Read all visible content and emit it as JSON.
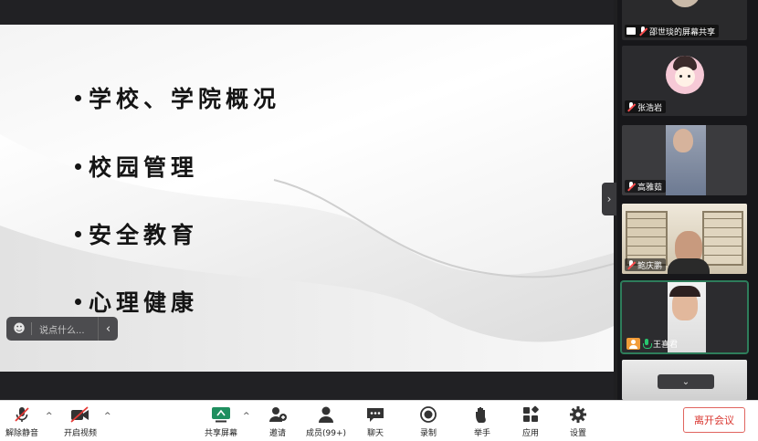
{
  "slide": {
    "bullets": [
      "学校、学院概况",
      "校园管理",
      "安全教育",
      "心理健康"
    ]
  },
  "chat_input": {
    "placeholder": "说点什么..."
  },
  "gallery": {
    "screen_share_label": "邵世琰的屏幕共享",
    "participants": [
      {
        "name": "张浩岩",
        "muted": true
      },
      {
        "name": "高雅茹",
        "muted": true
      },
      {
        "name": "鲍庆鹏",
        "muted": true
      },
      {
        "name": "王喜君",
        "muted": false
      }
    ]
  },
  "toolbar": {
    "unmute": "解除静音",
    "start_video": "开启视频",
    "share_screen": "共享屏幕",
    "invite": "邀请",
    "members": "成员(99+)",
    "chat": "聊天",
    "record": "录制",
    "raise_hand": "举手",
    "apps": "应用",
    "settings": "设置",
    "leave": "离开会议"
  },
  "colors": {
    "active_border": "#2e7d5b",
    "leave_text": "#d9362f",
    "muted_slash": "#ff4d4f",
    "mic_active": "#28c76f"
  }
}
